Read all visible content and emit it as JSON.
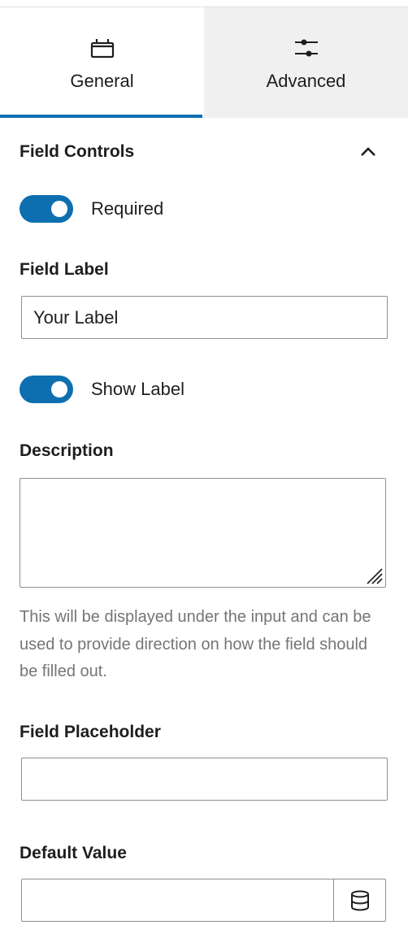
{
  "tabs": [
    {
      "label": "General",
      "icon": "calendar-icon",
      "active": true
    },
    {
      "label": "Advanced",
      "icon": "sliders-icon",
      "active": false
    }
  ],
  "panel": {
    "title": "Field Controls",
    "collapse_icon": "chevron-up-icon"
  },
  "required": {
    "label": "Required",
    "on": true
  },
  "field_label": {
    "title": "Field Label",
    "value": "Your Label"
  },
  "show_label": {
    "label": "Show Label",
    "on": true
  },
  "description": {
    "title": "Description",
    "value": "",
    "help": "This will be displayed under the input and can be used to provide direction on how the field should be filled out."
  },
  "placeholder": {
    "title": "Field Placeholder",
    "value": ""
  },
  "default_value": {
    "title": "Default Value",
    "value": "",
    "button_icon": "database-icon"
  },
  "colors": {
    "accent": "#0d6fb0",
    "inactive_tab": "#f0f0f0",
    "help_text": "#757575"
  }
}
